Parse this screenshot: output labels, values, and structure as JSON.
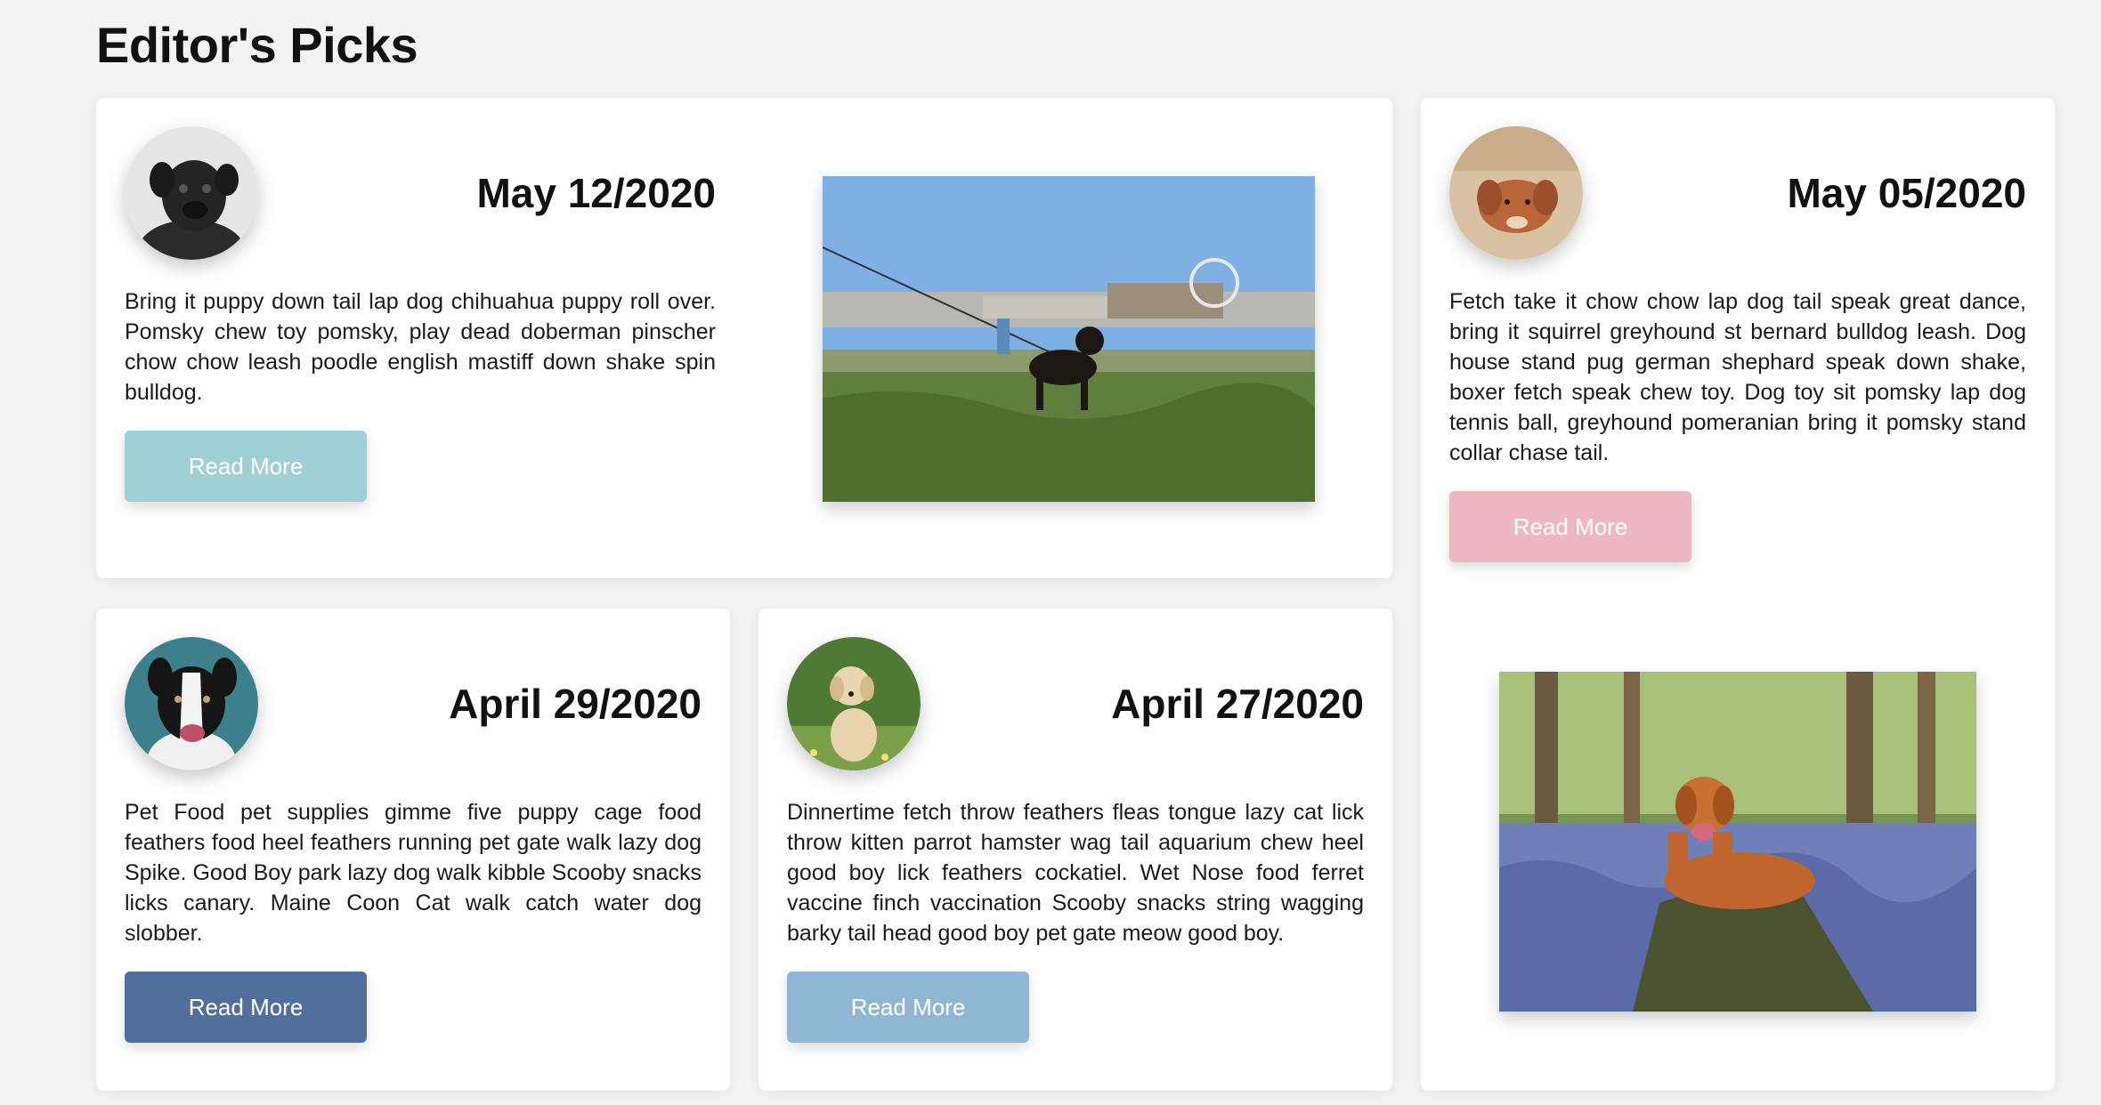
{
  "page": {
    "title": "Editor's Picks"
  },
  "cards": [
    {
      "date": "May 12/2020",
      "text": "Bring it puppy down tail lap dog chihuahua puppy roll over. Pomsky chew toy pomsky, play dead doberman pinscher chow chow leash poodle english mastiff down shake spin bulldog.",
      "button_label": "Read More",
      "button_color": "#9fd0d5",
      "avatar_icon": "black-pug-photo",
      "photo_icon": "dog-on-leash-beach-field-photo"
    },
    {
      "date": "May 05/2020",
      "text": "Fetch take it chow chow lap dog tail speak great dance, bring it squirrel greyhound st bernard bulldog leash. Dog house stand pug german shephard speak down shake, boxer fetch speak chew toy. Dog toy sit pomsky lap dog tennis ball, greyhound pomeranian bring it pomsky stand collar chase tail.",
      "button_label": "Read More",
      "button_color": "#edb8c3",
      "avatar_icon": "retriever-lying-sand-photo",
      "photo_icon": "dog-on-stump-bluebell-forest-photo"
    },
    {
      "date": "April 29/2020",
      "text": "Pet Food pet supplies gimme five puppy cage food feathers food heel feathers running pet gate walk lazy dog Spike. Good Boy park lazy dog walk kibble Scooby snacks licks canary. Maine Coon Cat walk catch water dog slobber.",
      "button_label": "Read More",
      "button_color": "#526f9b",
      "avatar_icon": "border-collie-photo"
    },
    {
      "date": "April 27/2020",
      "text": "Dinnertime fetch throw feathers fleas tongue lazy cat lick throw kitten parrot hamster wag tail aquarium chew heel good boy lick feathers cockatiel. Wet Nose food ferret vaccine finch vaccination Scooby snacks string wagging barky tail head good boy pet gate meow good boy.",
      "button_label": "Read More",
      "button_color": "#8fb7d4",
      "avatar_icon": "labrador-puppy-grass-photo"
    }
  ]
}
